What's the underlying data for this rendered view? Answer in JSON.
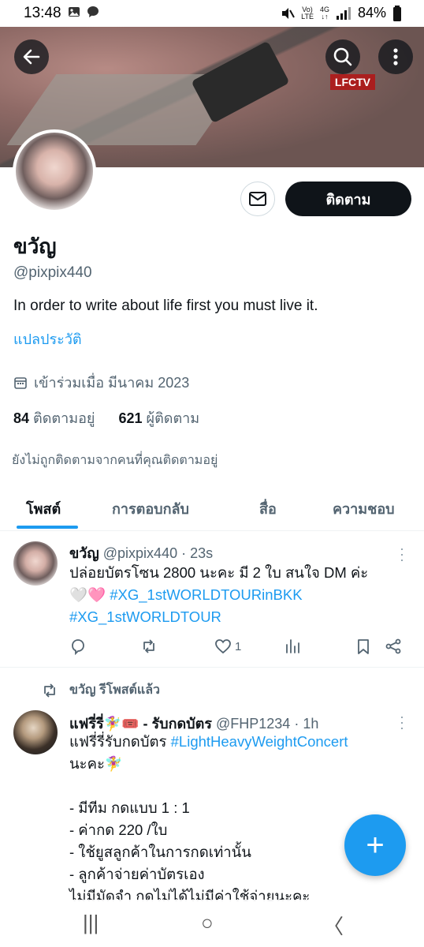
{
  "status_bar": {
    "time": "13:48",
    "network_top": "Vo)",
    "network_bottom": "LTE",
    "data_top": "4G",
    "data_bottom": "↓↑",
    "battery": "84%"
  },
  "banner": {
    "watermark": "LFCTV"
  },
  "profile": {
    "display_name": "ขวัญ",
    "handle": "@pixpix440",
    "bio": "In order to write about life first you must live it.",
    "translate_bio": "แปลประวัติ",
    "joined": "เข้าร่วมเมื่อ มีนาคม 2023",
    "following_count": "84",
    "following_label": "ติดตามอยู่",
    "followers_count": "621",
    "followers_label": "ผู้ติดตาม",
    "not_followed_note": "ยังไม่ถูกติดตามจากคนที่คุณติดตามอยู่",
    "follow_label": "ติดตาม"
  },
  "tabs": [
    {
      "label": "โพสต์",
      "active": true
    },
    {
      "label": "การตอบกลับ",
      "active": false
    },
    {
      "label": "สื่อ",
      "active": false
    },
    {
      "label": "ความชอบ",
      "active": false
    }
  ],
  "tweets": [
    {
      "author": "ขวัญ",
      "handle": "@pixpix440",
      "time": "· 23s",
      "text_line1": "ปล่อยบัตรโซน 2800 นะคะ มี 2 ใบ  สนใจ DM ค่ะ",
      "hearts": "🤍🩷",
      "hashtag1": "#XG_1stWORLDTOURinBKK",
      "hashtag2": "#XG_1stWORLDTOUR",
      "like_count": "1"
    },
    {
      "retweet_note": "ขวัญ รีโพสต์แล้ว",
      "author": "แฟรี่รี่🧚‍♀️🎟️ - รับกดบัตร",
      "handle": "@FHP1234",
      "time": "· 1h",
      "text_prefix": "แฟรี่รี่รับกดบัตร ",
      "hashtag": "#LightHeavyWeightConcert",
      "line2": "นะคะ🧚‍♀️",
      "line3": "- มีทีม กดแบบ 1 : 1",
      "line4": "- ค่ากด 220 /ใบ",
      "line5": "- ใช้ยูสลูกค้าในการกดเท่านั้น",
      "line6": "- ลูกค้าจ่ายค่าบัตรเอง",
      "line7": "ไม่มีมัดจำ กดไม่ได้ไม่มีค่าใช้จ่ายนะคะ"
    }
  ],
  "fab_symbol": "+",
  "nav": {
    "recents": "|||",
    "home": "○",
    "back": "〈"
  }
}
